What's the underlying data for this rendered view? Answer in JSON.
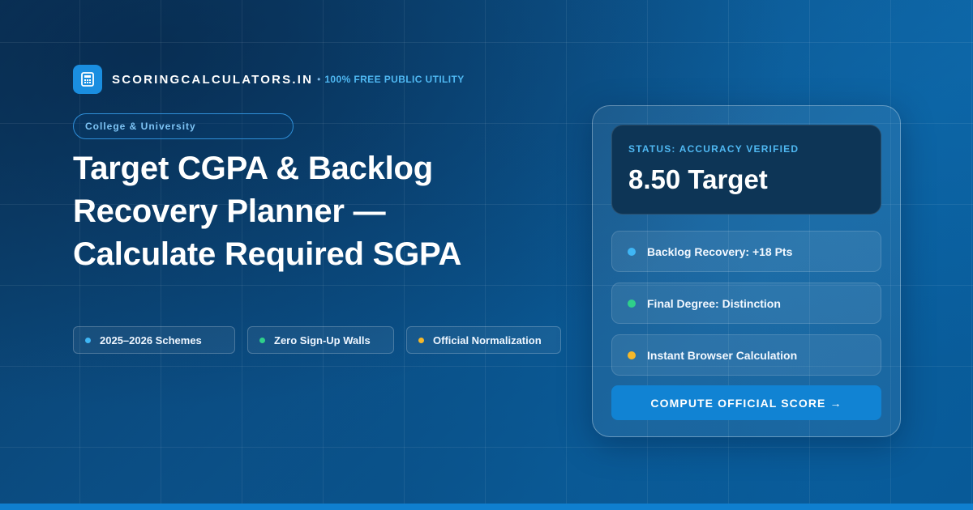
{
  "brand": {
    "name": "SCORINGCALCULATORS.IN",
    "separator": "•",
    "tagline": "100% FREE PUBLIC UTILITY",
    "logo_icon": "calculator-icon"
  },
  "category": "College & University",
  "headline": {
    "line1": "Target CGPA & Backlog",
    "line2": "Recovery Planner —",
    "line3": "Calculate Required SGPA"
  },
  "features": [
    {
      "label": "2025–2026 Schemes",
      "color": "#3fb6f5"
    },
    {
      "label": "Zero Sign-Up Walls",
      "color": "#2fd08a"
    },
    {
      "label": "Official Normalization",
      "color": "#f5b82a"
    }
  ],
  "card": {
    "status_label": "STATUS: ACCURACY VERIFIED",
    "status_value": "8.50 Target",
    "rows": [
      {
        "label": "Backlog Recovery: +18 Pts",
        "color": "#3fb6f5"
      },
      {
        "label": "Final Degree: Distinction",
        "color": "#2fd08a"
      },
      {
        "label": "Instant Browser Calculation",
        "color": "#f5b82a"
      }
    ],
    "button_label": "COMPUTE OFFICIAL SCORE →"
  },
  "colors": {
    "accent": "#1183d3",
    "brand_blue": "#4fb8f2",
    "background": "#0b4f86"
  }
}
